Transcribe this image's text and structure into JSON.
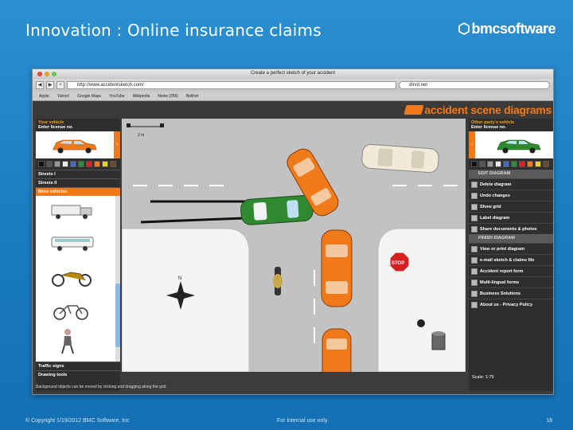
{
  "slide": {
    "title": "Innovation : Online insurance claims",
    "logo": "bmcsoftware",
    "footer_left": "© Copyright 1/19/2012 BMC Software, Inc",
    "footer_mid": "For internal use only.",
    "footer_right": "18"
  },
  "browser": {
    "window_title": "Create a perfect sketch of your accident",
    "url": "http://www.accidentsketch.com/",
    "search": "dirvd.net",
    "bookmarks": [
      "Apple",
      "Yahoo!",
      "Google Maps",
      "YouTube",
      "Wikipedia",
      "News (356)",
      "Bellnet"
    ]
  },
  "app": {
    "logo": "accident scene diagrams",
    "left_panel": {
      "your_vehicle": "Your vehicle",
      "license": "Enter license no.",
      "menu": [
        "Streets I",
        "Streets II",
        "More vehicles",
        "Traffic signs",
        "Drawing tools"
      ]
    },
    "right_panel": {
      "other_vehicle": "Other party's vehicle",
      "license": "Enter license no.",
      "edit_section": "EDIT DIAGRAM",
      "edit_actions": [
        "Delete diagram",
        "Undo changes",
        "Show grid",
        "Label diagram",
        "Share documents & photos"
      ],
      "finish_section": "FINISH DIAGRAM",
      "finish_actions": [
        "View or print diagram",
        "e-mail sketch & claims file",
        "Accident report form",
        "Multi-lingual forms",
        "Business Solutions",
        "About us - Privacy Policy"
      ]
    },
    "hint": "Background objects can be moved by clicking and dragging along the grid.",
    "scale": "Scale: 1:75",
    "ruler": "2 m",
    "stop": "STOP",
    "compass": "N"
  },
  "colors": {
    "accent": "#f07a1a",
    "slide_bg": "#1b7ec3"
  }
}
